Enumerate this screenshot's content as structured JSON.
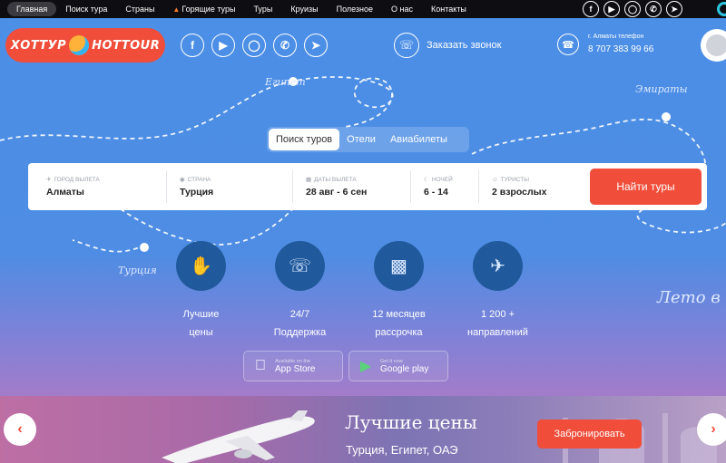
{
  "topnav": {
    "items": [
      {
        "label": "Главная",
        "active": true
      },
      {
        "label": "Поиск тура"
      },
      {
        "label": "Страны"
      },
      {
        "label": "Горящие туры",
        "icon": "fire-icon"
      },
      {
        "label": "Туры"
      },
      {
        "label": "Круизы"
      },
      {
        "label": "Полезное"
      },
      {
        "label": "О нас"
      },
      {
        "label": "Контакты"
      }
    ],
    "socials": [
      "facebook-icon",
      "youtube-icon",
      "instagram-icon",
      "whatsapp-icon",
      "telegram-icon"
    ]
  },
  "header": {
    "logo_left": "ХОТТУР",
    "logo_right": "HOTTOUR",
    "socials": [
      "facebook-icon",
      "youtube-icon",
      "instagram-icon",
      "whatsapp-icon",
      "telegram-icon"
    ],
    "callback_label": "Заказать звонок",
    "phone_label": "г. Алматы телефон",
    "phone_number": "8 707 383 99 66"
  },
  "map_words": {
    "egypt": "Египет",
    "emirates": "Эмираты",
    "turkey": "Турция",
    "summer": "Лето в"
  },
  "search": {
    "tabs": [
      {
        "label": "Поиск туров",
        "active": true
      },
      {
        "label": "Отели"
      },
      {
        "label": "Авиабилеты"
      }
    ],
    "fields": [
      {
        "label": "ГОРОД ВЫЛЕТА",
        "value": "Алматы",
        "icon": "plane-icon"
      },
      {
        "label": "СТРАНА",
        "value": "Турция",
        "icon": "location-pin-icon"
      },
      {
        "label": "ДАТЫ ВЫЛЕТА",
        "value": "28 авг - 6 сен",
        "icon": "calendar-icon"
      },
      {
        "label": "НОЧЕЙ",
        "value": "6 - 14",
        "icon": "moon-icon"
      },
      {
        "label": "ТУРИСТЫ",
        "value": "2 взрослых",
        "icon": "person-icon"
      }
    ],
    "find_button": "Найти туры"
  },
  "features": [
    {
      "line1": "Лучшие",
      "line2": "цены",
      "icon": "hand-coin-icon"
    },
    {
      "line1": "24/7",
      "line2": "Поддержка",
      "icon": "headset-icon"
    },
    {
      "line1": "12 месяцев",
      "line2": "рассрочка",
      "icon": "wallet-icon"
    },
    {
      "line1": "1 200 +",
      "line2": "направлений",
      "icon": "airplane-icon"
    }
  ],
  "apps": [
    {
      "small": "Available on the",
      "big": "App Store",
      "icon": "apple-icon"
    },
    {
      "small": "Get it now",
      "big": "Google play",
      "icon": "google-play-icon"
    }
  ],
  "banner": {
    "title": "Лучшие цены",
    "subtitle": "Турция, Египет, ОАЭ",
    "book_button": "Забронировать",
    "prev_icon": "chevron-left-icon",
    "next_icon": "chevron-right-icon"
  },
  "colors": {
    "accent": "#f04d3a",
    "background": "#4b8fe6",
    "feature_circle": "#215a9c",
    "topbar": "#0d0d12"
  }
}
